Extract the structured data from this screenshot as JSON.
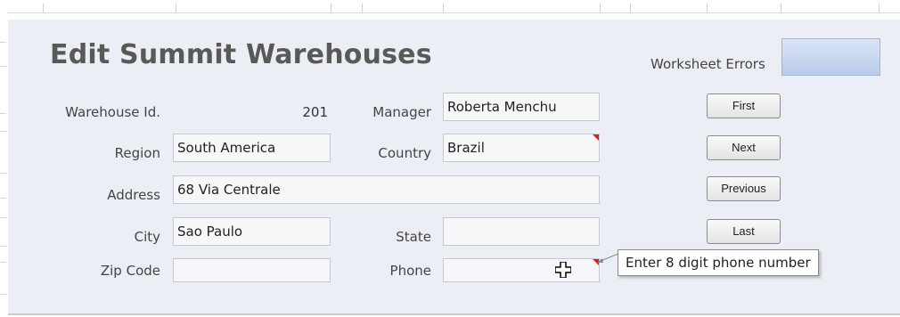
{
  "form": {
    "title": "Edit Summit Warehouses",
    "worksheet_errors_label": "Worksheet Errors",
    "fields": {
      "warehouse_id": {
        "label": "Warehouse Id.",
        "value": "201"
      },
      "manager": {
        "label": "Manager",
        "value": "Roberta Menchu"
      },
      "region": {
        "label": "Region",
        "value": "South America"
      },
      "country": {
        "label": "Country",
        "value": "Brazil"
      },
      "address": {
        "label": "Address",
        "value": "68 Via Centrale"
      },
      "city": {
        "label": "City",
        "value": "Sao Paulo"
      },
      "state": {
        "label": "State",
        "value": ""
      },
      "zip_code": {
        "label": "Zip Code",
        "value": ""
      },
      "phone": {
        "label": "Phone",
        "value": ""
      }
    },
    "buttons": {
      "first": "First",
      "next": "Next",
      "previous": "Previous",
      "last": "Last"
    },
    "tooltip": "Enter 8 digit phone number"
  },
  "colors": {
    "panel_background": "#eceef5",
    "comment_indicator": "#e0201b",
    "title_text": "#595959"
  },
  "icons": {
    "comment_indicator": "red-triangle-icon",
    "cursor": "crosshair-cursor-icon"
  }
}
